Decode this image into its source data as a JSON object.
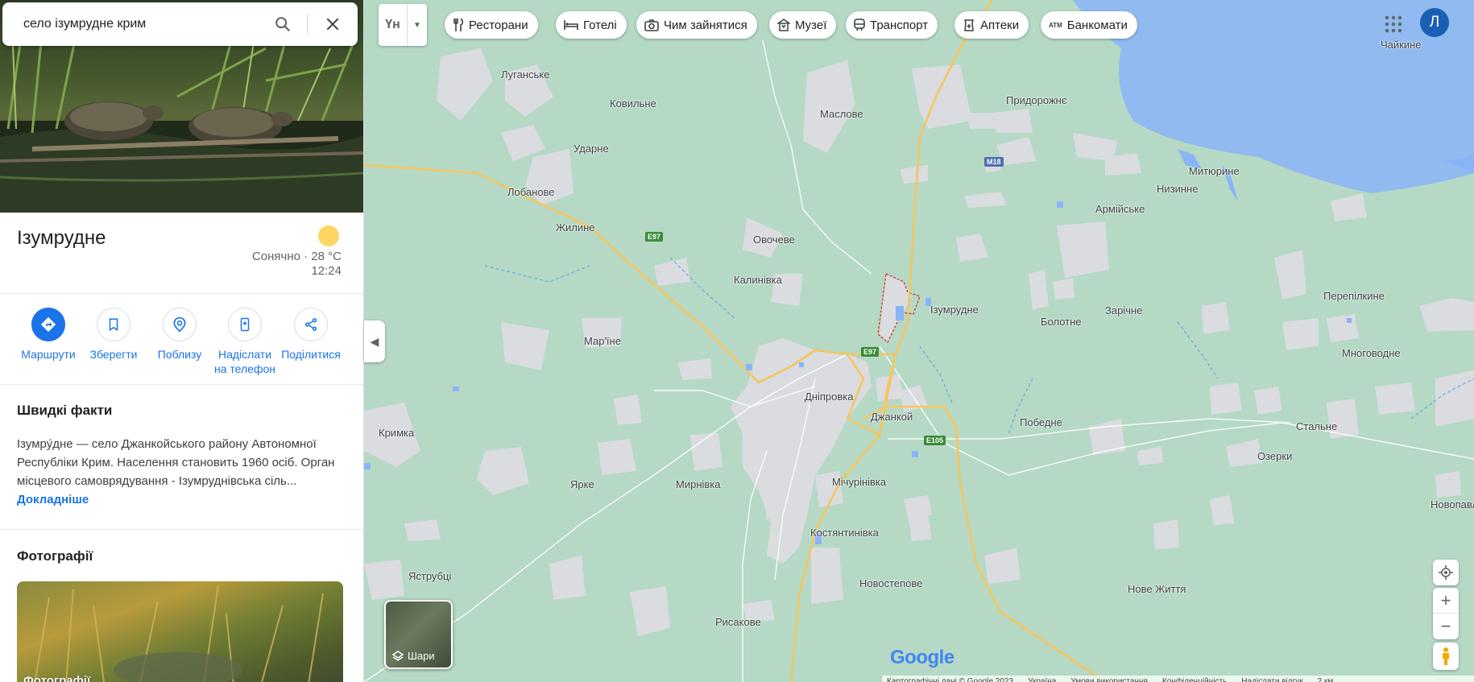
{
  "search": {
    "value": "село ізумрудне крим"
  },
  "place": {
    "title": "Ізумрудне",
    "weather": "Сонячно · 28 °C",
    "time": "12:24"
  },
  "actions": [
    {
      "label": "Маршрути"
    },
    {
      "label": "Зберегти"
    },
    {
      "label": "Поблизу"
    },
    {
      "label": "Надіслати на телефон"
    },
    {
      "label": "Поділитися"
    }
  ],
  "quick_facts": {
    "heading": "Швидкі факти",
    "text": "Ізумру́дне — село Джанкойського району Автономної Республіки Крим. Населення становить 1960 осіб. Орган місцевого самоврядування - Ізумруднівська сіль...",
    "more_link": "Докладніше"
  },
  "photos": {
    "heading": "Фотографії",
    "tile_label": "Фотографії"
  },
  "map_toolbar": {
    "lang_label": "Үн",
    "chips": [
      {
        "label": "Ресторани",
        "icon": "restaurant-icon"
      },
      {
        "label": "Готелі",
        "icon": "hotel-icon"
      },
      {
        "label": "Чим зайнятися",
        "icon": "camera-icon"
      },
      {
        "label": "Музеї",
        "icon": "museum-icon"
      },
      {
        "label": "Транспорт",
        "icon": "transit-icon"
      },
      {
        "label": "Аптеки",
        "icon": "pharmacy-icon"
      },
      {
        "label": "Банкомати",
        "icon": "atm-icon"
      }
    ]
  },
  "account": {
    "initial": "Л"
  },
  "layers": {
    "label": "Шари"
  },
  "map_labels": {
    "chaikyne": "Чайкине",
    "luhanske": "Луганське",
    "kovylne": "Ковильне",
    "maslove": "Маслове",
    "prydorozhne": "Придорожнє",
    "udarne": "Ударне",
    "lobanove": "Лобанове",
    "zhyline": "Жилине",
    "ovocheve": "Овочеве",
    "kalynivka": "Калинівка",
    "mytiuryne": "Митюрине",
    "nyzynne": "Низинне",
    "armiiske": "Армійське",
    "izumrudne": "Ізумрудне",
    "zarichne": "Зарічне",
    "perepilkyne": "Перепілкине",
    "bolotne": "Болотне",
    "marine": "Мар'їне",
    "mnohovodne": "Многоводне",
    "dniprovka": "Дніпровка",
    "dzhankoi": "Джанкой",
    "pobiedne": "Победне",
    "stalne": "Стальне",
    "krymka": "Кримка",
    "ozerky": "Озерки",
    "yarke": "Ярке",
    "myrnivka": "Мирнівка",
    "michurinivka": "Мічурінівка",
    "novopavlivka": "Новопавлі",
    "kostiantynivka": "Костянтинівка",
    "yastrubtsi": "Яструбці",
    "nove_zhyttia": "Нове Життя",
    "novostepove": "Новостепове",
    "rysakove": "Рисакове"
  },
  "road_shields": {
    "m18": "M18",
    "e97_a": "E97",
    "e97_b": "E97",
    "e105": "E105"
  },
  "brand": {
    "logo": "Google"
  },
  "footer": {
    "items": [
      "Картографічні дані © Google 2023",
      "Україна",
      "Умови використання",
      "Конфіденційність",
      "Надіслати відгук",
      "2 км"
    ]
  },
  "colors": {
    "accent": "#1a73e8",
    "map_bg": "#b5d9c4",
    "water": "#8ab4f8",
    "road": "#f6c560"
  }
}
